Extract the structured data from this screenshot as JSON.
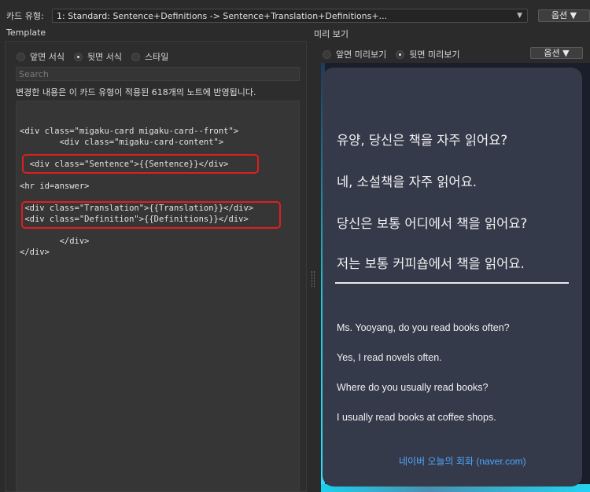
{
  "header": {
    "card_type_label": "카드 유형:",
    "card_type_value": "1: Standard: Sentence+Definitions -> Sentence+Translation+Definitions+...",
    "options_label": "옵션 ▼"
  },
  "template": {
    "title": "Template",
    "tabs": [
      {
        "label": "앞면 서식",
        "selected": false
      },
      {
        "label": "뒷면 서식",
        "selected": true
      },
      {
        "label": "스타일",
        "selected": false
      }
    ],
    "search_placeholder": "Search",
    "notice": "변경한 내용은 이 카드 유형이 적용된 618개의 노트에 반영됩니다.",
    "code_lines": [
      "<div class=\"migaku-card migaku-card--front\">",
      "        <div class=\"migaku-card-content\">",
      "  <div class=\"Sentence\">{{Sentence}}</div>",
      "<hr id=answer>",
      " <div class=\"Translation\">{{Translation}}</div>",
      " <div class=\"Definition\">{{Definitions}}</div>",
      "        </div>",
      "</div>"
    ]
  },
  "preview": {
    "title": "미리 보기",
    "tabs": [
      {
        "label": "앞면 미리보기",
        "selected": false
      },
      {
        "label": "뒷면 미리보기",
        "selected": true
      }
    ],
    "options_label": "옵션 ▼",
    "sentences": [
      "유양, 당신은 책을 자주 읽어요?",
      "네, 소설책을 자주 읽어요.",
      "당신은 보통 어디에서 책을 읽어요?",
      "저는 보통 커피숍에서 책을 읽어요."
    ],
    "translations": [
      "Ms. Yooyang, do you read books often?",
      "Yes, I read novels often.",
      "Where do you usually read books?",
      "I usually read books at coffee shops."
    ],
    "source_link": "네이버 오늘의 회화 (naver.com)"
  },
  "colors": {
    "highlight_box": "#e01e1e",
    "link": "#4ea7ff",
    "card_bg": "#353a4a"
  }
}
